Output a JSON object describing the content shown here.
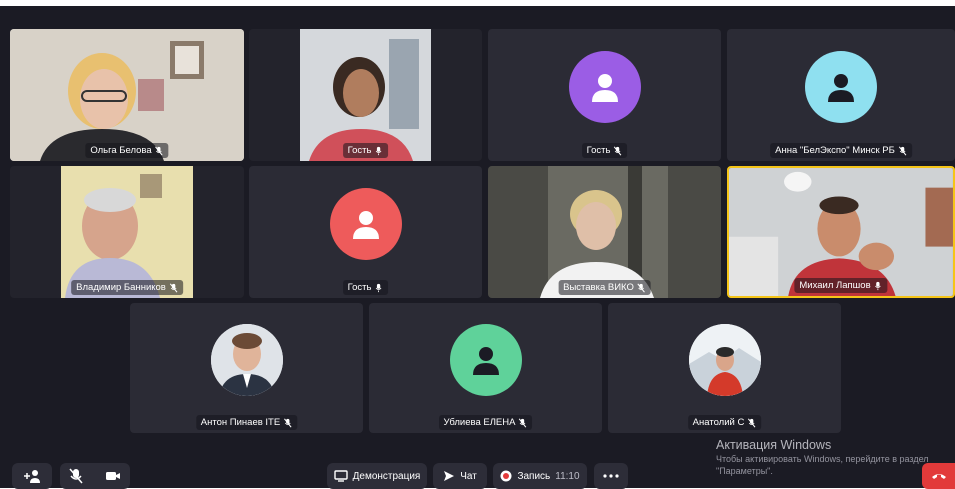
{
  "participants": {
    "p1": {
      "name": "Ольга Белова",
      "mic": "muted"
    },
    "p2": {
      "name": "Гость",
      "mic": "on"
    },
    "p3": {
      "name": "Гость",
      "mic": "muted"
    },
    "p4": {
      "name": "Анна \"БелЭкспо\" Минск РБ",
      "mic": "muted"
    },
    "p5": {
      "name": "Владимир Банников",
      "mic": "muted"
    },
    "p6": {
      "name": "Гость",
      "mic": "on"
    },
    "p7": {
      "name": "Выставка ВИКО",
      "mic": "muted"
    },
    "p8": {
      "name": "Михаил Лапшов",
      "mic": "on",
      "active_speaker": true
    },
    "p9": {
      "name": "Антон Пинаев ITE",
      "mic": "muted"
    },
    "p10": {
      "name": "Ублиева ЕЛЕНА",
      "mic": "muted"
    },
    "p11": {
      "name": "Анатолий С",
      "mic": "muted"
    }
  },
  "avatar_colors": {
    "p3": "#9b5de5",
    "p4": "#8fe0f0",
    "p6": "#ee5b5b",
    "p10": "#5fd29a"
  },
  "toolbar": {
    "share_label": "Демонстрация",
    "chat_label": "Чат",
    "record_label": "Запись",
    "record_time": "11:10"
  },
  "watermark": {
    "title": "Активация Windows",
    "line1": "Чтобы активировать Windows, перейдите в раздел",
    "line2": "\"Параметры\"."
  },
  "icons": [
    "add-participant-icon",
    "mic-muted-icon",
    "camera-icon",
    "screen-share-icon",
    "chat-send-icon",
    "record-icon",
    "more-icon",
    "hangup-icon"
  ]
}
